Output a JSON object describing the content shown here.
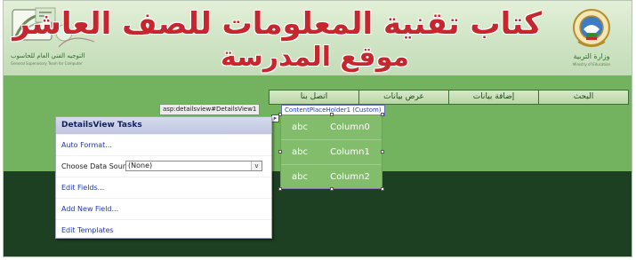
{
  "header": {
    "title_line1": "كتاب تقنية المعلومات للصف العاشر",
    "title_line2": "موقع المدرسة",
    "left_logo_caption": "التوجيه الفني العام للحاسوب",
    "left_logo_tagline": "General Supervisory Team for Computer",
    "ministry_name": "وزارة التربية",
    "ministry_subtitle": "Ministry of Education"
  },
  "nav": {
    "items": [
      "اتصل بنا",
      "عرض بيانات",
      "إضافة بيانات",
      "البحث"
    ]
  },
  "designer": {
    "detailsview_tag": "asp:detailsview#DetailsView1",
    "placeholder_tag": "ContentPlaceHolder1 (Custom)",
    "smart_tag_glyph": "▸"
  },
  "details_grid": {
    "rows": [
      {
        "value": "abc",
        "field": "Column0"
      },
      {
        "value": "abc",
        "field": "Column1"
      },
      {
        "value": "abc",
        "field": "Column2"
      }
    ]
  },
  "tasks_panel": {
    "title": "DetailsView Tasks",
    "auto_format": "Auto Format...",
    "choose_ds_label": "Choose Data Source:",
    "choose_ds_value": "(None)",
    "dropdown_arrow": "v",
    "edit_fields": "Edit Fields...",
    "add_new_field": "Add New Field...",
    "edit_templates": "Edit Templates"
  },
  "colors": {
    "title_red": "#c6262e",
    "strip_green": "#73b25f",
    "footer_dark": "#1d3f22",
    "link_blue": "#1e3aa8"
  }
}
